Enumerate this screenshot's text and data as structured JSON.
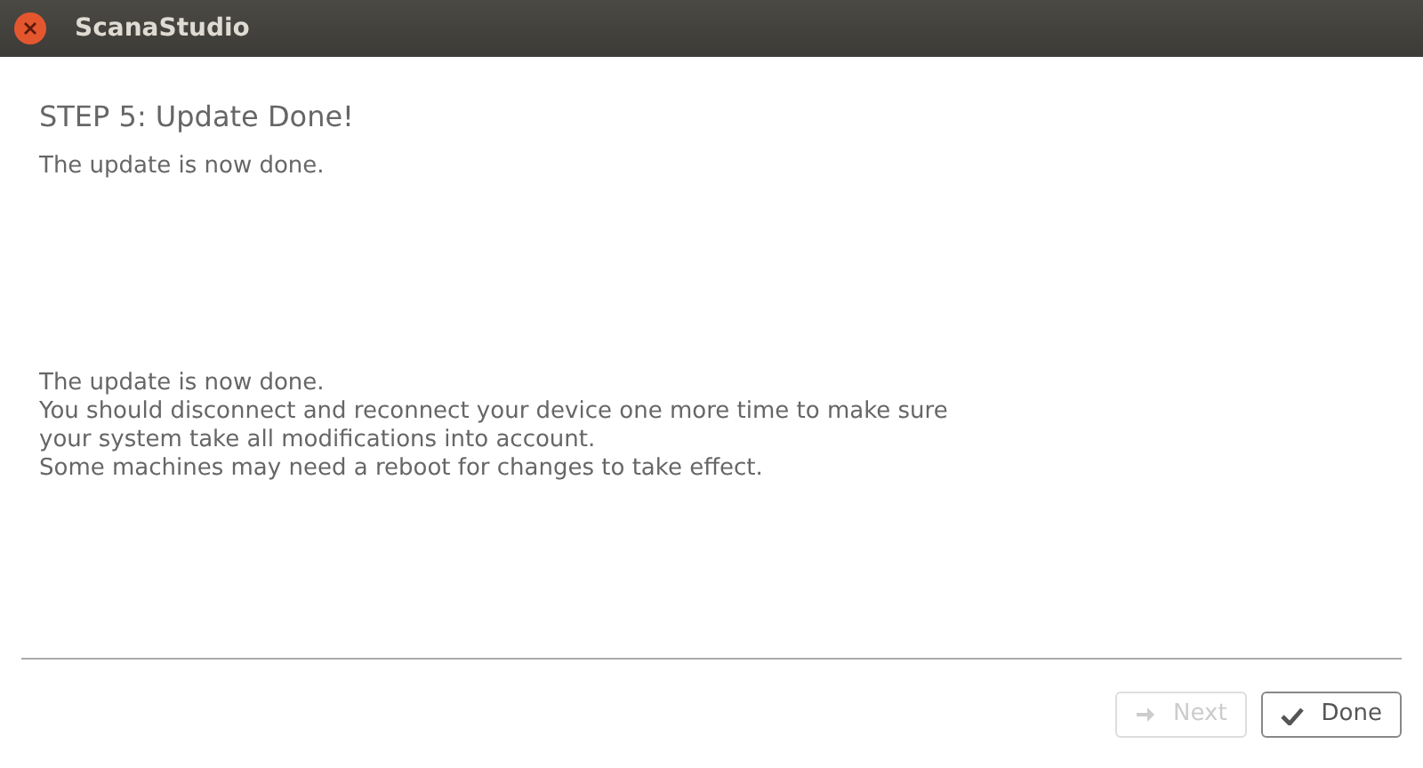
{
  "window": {
    "title": "ScanaStudio"
  },
  "heading": "STEP 5: Update Done!",
  "subtitle": "The update is now done.",
  "message": [
    "The update is now done.",
    "You should disconnect and reconnect your device one more time to make sure",
    "your system take all modifications into account.",
    "Some machines may need a reboot for changes to take effect."
  ],
  "buttons": [
    {
      "label": "Next",
      "kind": "next",
      "disabled": true
    },
    {
      "label": "Done",
      "kind": "done",
      "disabled": false
    }
  ]
}
